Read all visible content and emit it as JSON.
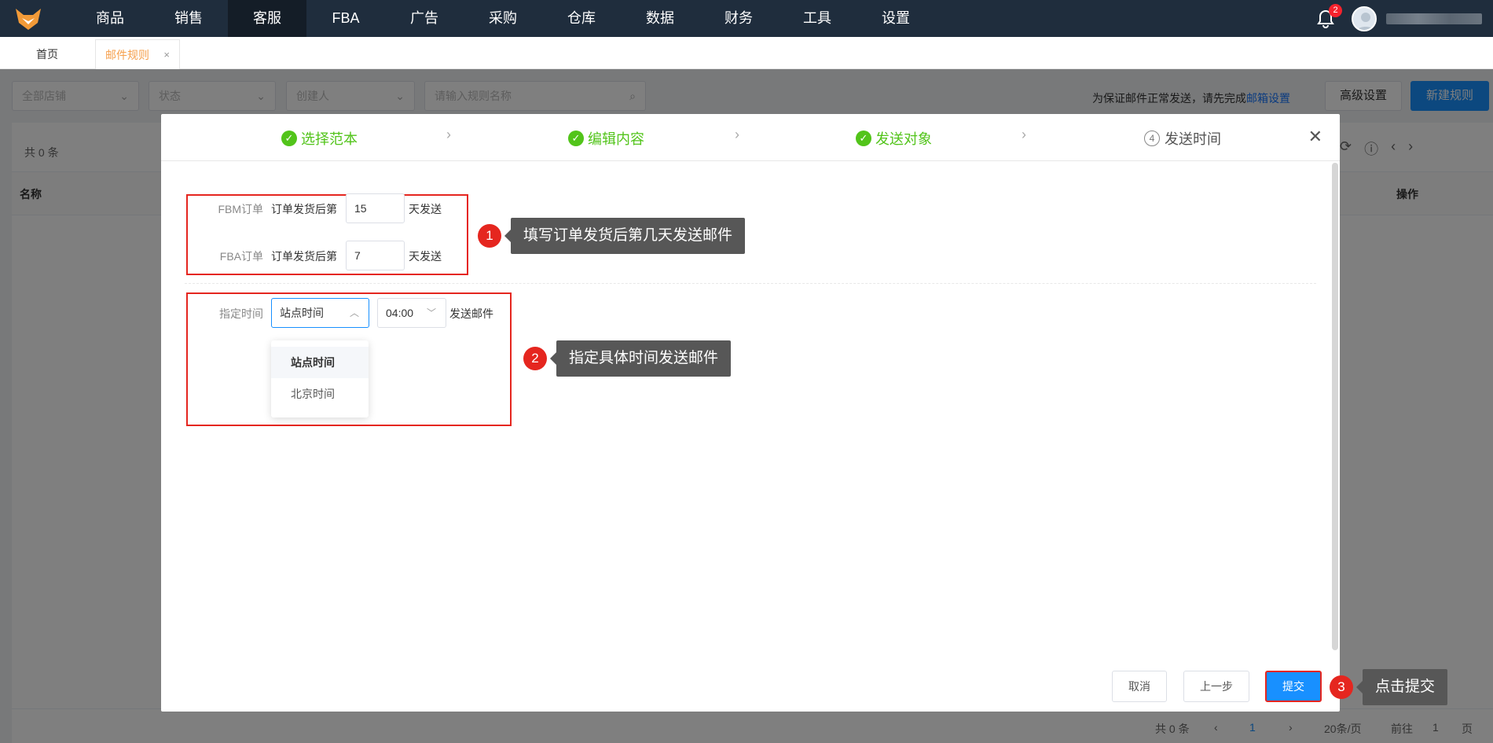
{
  "nav": {
    "items": [
      "商品",
      "销售",
      "客服",
      "FBA",
      "广告",
      "采购",
      "仓库",
      "数据",
      "财务",
      "工具",
      "设置"
    ],
    "active_index": 2,
    "notification_count": "2"
  },
  "tabs": {
    "home": "首页",
    "current": "邮件规则",
    "close": "×"
  },
  "filters": {
    "shop": "全部店铺",
    "status": "状态",
    "creator": "创建人",
    "search_placeholder": "请输入规则名称"
  },
  "hint": {
    "text": "为保证邮件正常发送，请先完成",
    "link": "邮箱设置"
  },
  "buttons": {
    "advanced": "高级设置",
    "new_rule": "新建规则"
  },
  "list": {
    "total": "共 0 条",
    "col_name": "名称",
    "col_op": "操作"
  },
  "pager": {
    "total": "共 0 条",
    "page": "1",
    "size": "20条/页",
    "goto": "前往",
    "goto_val": "1",
    "unit": "页"
  },
  "modal": {
    "steps": [
      {
        "label": "选择范本",
        "state": "done"
      },
      {
        "label": "编辑内容",
        "state": "done"
      },
      {
        "label": "发送对象",
        "state": "done"
      },
      {
        "label": "发送时间",
        "state": "current",
        "num": "4"
      }
    ],
    "fbm": {
      "label": "FBM订单",
      "prefix": "订单发货后第",
      "value": "15",
      "suffix": "天发送"
    },
    "fba": {
      "label": "FBA订单",
      "prefix": "订单发货后第",
      "value": "7",
      "suffix": "天发送"
    },
    "schedule": {
      "label": "指定时间",
      "zone": "站点时间",
      "time": "04:00",
      "suffix": "发送邮件",
      "options": [
        "站点时间",
        "北京时间"
      ]
    },
    "buttons": {
      "cancel": "取消",
      "prev": "上一步",
      "submit": "提交"
    }
  },
  "callouts": [
    {
      "num": "1",
      "text": "填写订单发货后第几天发送邮件"
    },
    {
      "num": "2",
      "text": "指定具体时间发送邮件"
    },
    {
      "num": "3",
      "text": "点击提交"
    }
  ],
  "colors": {
    "topbar": "#1f2d3d",
    "primary": "#1890ff",
    "success": "#52c41a",
    "highlight": "#e5261f",
    "tab_active": "#f6a04d"
  }
}
